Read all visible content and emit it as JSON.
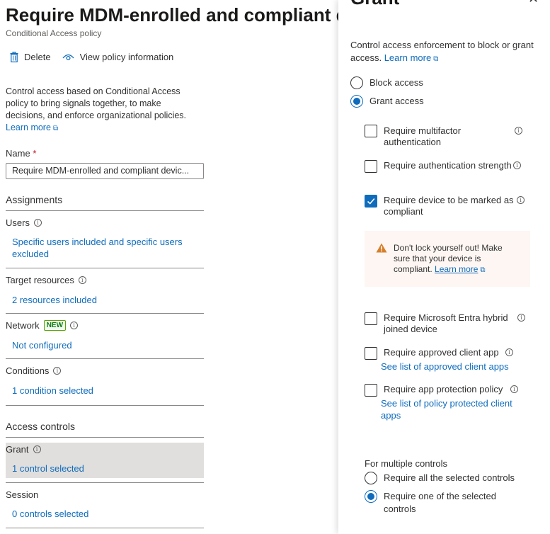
{
  "page": {
    "title": "Require MDM-enrolled and compliant devi",
    "subtitle": "Conditional Access policy"
  },
  "toolbar": {
    "delete_label": "Delete",
    "view_info_label": "View policy information"
  },
  "intro": {
    "text": "Control access based on Conditional Access policy to bring signals together, to make decisions, and enforce organizational policies.",
    "learn_more": "Learn more"
  },
  "name_field": {
    "label": "Name",
    "required_mark": "*",
    "value": "Require MDM-enrolled and compliant devic..."
  },
  "assignments": {
    "heading": "Assignments",
    "users": {
      "label": "Users",
      "value": "Specific users included and specific users excluded"
    },
    "target_resources": {
      "label": "Target resources",
      "value": "2 resources included"
    },
    "network": {
      "label": "Network",
      "badge": "NEW",
      "value": "Not configured"
    },
    "conditions": {
      "label": "Conditions",
      "value": "1 condition selected"
    }
  },
  "access_controls": {
    "heading": "Access controls",
    "grant": {
      "label": "Grant",
      "value": "1 control selected"
    },
    "session": {
      "label": "Session",
      "value": "0 controls selected"
    }
  },
  "panel": {
    "title": "Grant",
    "close_glyph": "✕",
    "description": "Control access enforcement to block or grant access.",
    "learn_more": "Learn more",
    "block_access": "Block access",
    "grant_access": "Grant access",
    "selected_access": "grant",
    "options": {
      "mfa": {
        "label": "Require multifactor authentication",
        "checked": false
      },
      "auth_strength": {
        "label": "Require authentication strength",
        "checked": false
      },
      "compliant": {
        "label": "Require device to be marked as compliant",
        "checked": true
      },
      "hybrid": {
        "label": "Require Microsoft Entra hybrid joined device",
        "checked": false
      },
      "approved_app": {
        "label": "Require approved client app",
        "link": "See list of approved client apps",
        "checked": false
      },
      "app_protection": {
        "label": "Require app protection policy",
        "link": "See list of policy protected client apps",
        "checked": false
      }
    },
    "warning": {
      "text": "Don't lock yourself out! Make sure that your device is compliant.",
      "learn_more": "Learn more"
    },
    "multiple_controls": {
      "label": "For multiple controls",
      "require_all": "Require all the selected controls",
      "require_one": "Require one of the selected controls",
      "selected": "one"
    }
  },
  "colors": {
    "link": "#0f6cbd",
    "accent": "#0f6cbd",
    "warning_bg": "#fdf6f3",
    "warning_icon": "#d67f2b",
    "badge_green": "#107c10",
    "highlight": "#e1dfdd"
  },
  "icons": [
    "trash-icon",
    "eye-icon",
    "info-icon",
    "external-link-icon",
    "warning-icon",
    "checkmark-icon",
    "close-icon"
  ]
}
